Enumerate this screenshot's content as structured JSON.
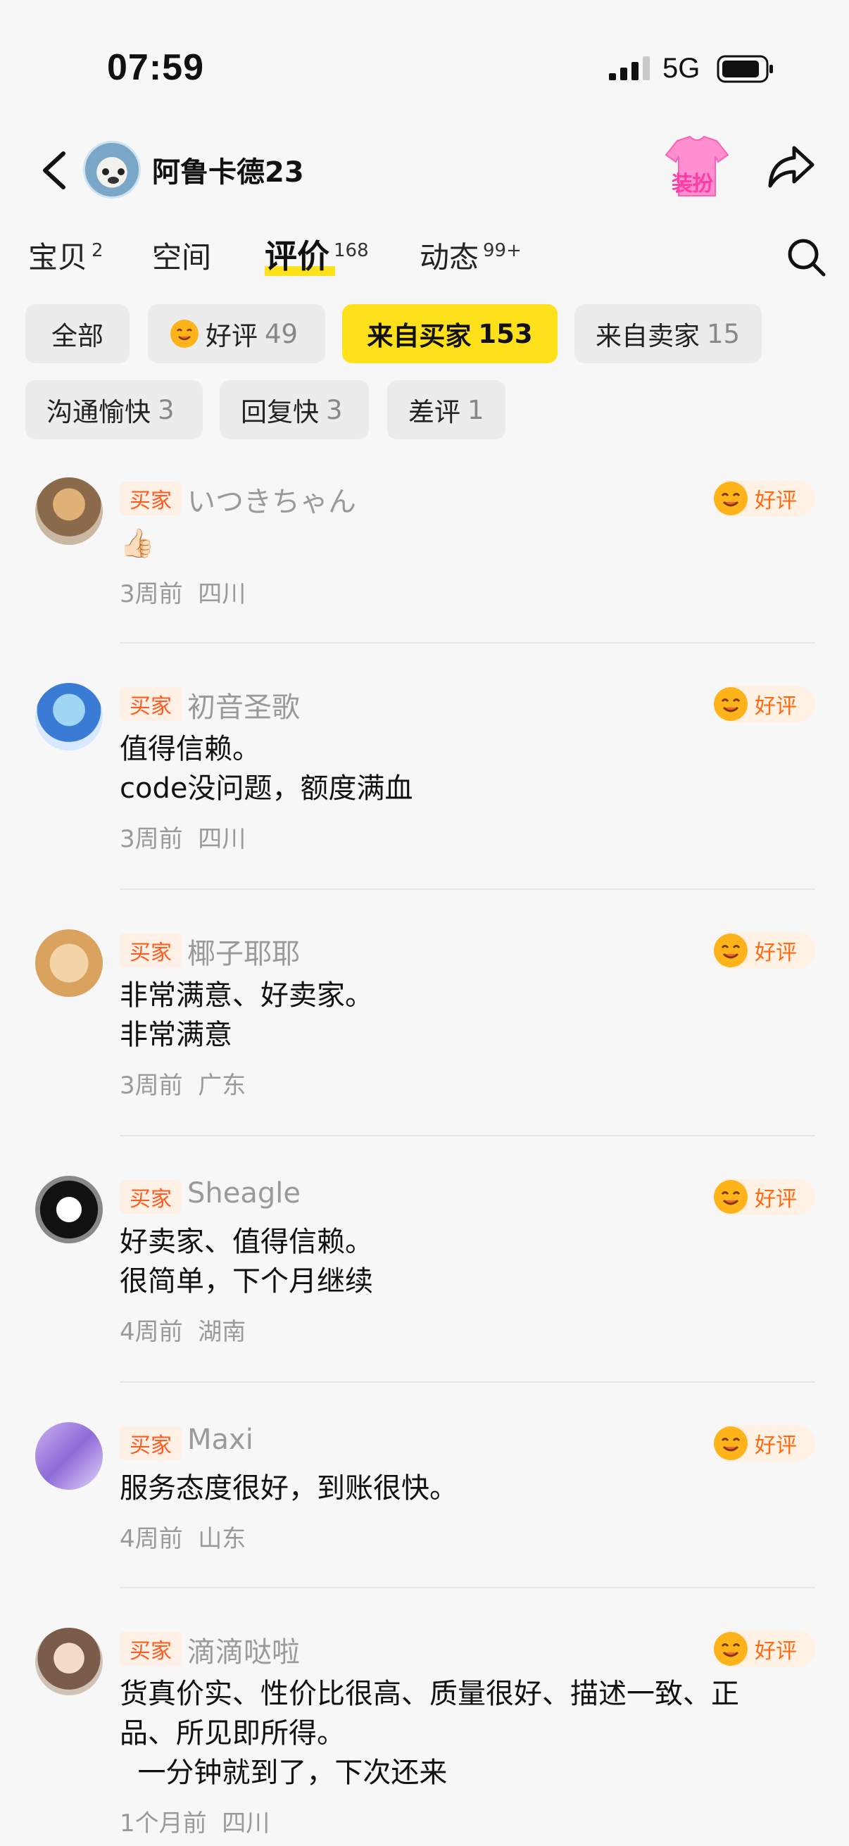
{
  "status_bar": {
    "time": "07:59",
    "network": "5G"
  },
  "header": {
    "user_name": "阿鲁卡德23",
    "dressup_label": "装扮"
  },
  "tabs": [
    {
      "label": "宝贝",
      "count": "2"
    },
    {
      "label": "空间",
      "count": ""
    },
    {
      "label": "评价",
      "count": "168",
      "active": true
    },
    {
      "label": "动态",
      "count": "99+"
    }
  ],
  "filters": [
    {
      "label": "全部",
      "count": ""
    },
    {
      "label": "好评",
      "count": "49"
    },
    {
      "label": "来自买家",
      "count": "153",
      "active": true
    },
    {
      "label": "来自卖家",
      "count": "15"
    },
    {
      "label": "沟通愉快",
      "count": "3"
    },
    {
      "label": "回复快",
      "count": "3"
    },
    {
      "label": "差评",
      "count": "1"
    }
  ],
  "reviews": [
    {
      "tag": "买家",
      "name": "いつきちゃん",
      "badge": "好评",
      "text": "👍🏻",
      "meta": "3周前  四川"
    },
    {
      "tag": "买家",
      "name": "初音圣歌",
      "badge": "好评",
      "text": "值得信赖。\ncode没问题，额度满血",
      "meta": "3周前  四川"
    },
    {
      "tag": "买家",
      "name": "椰子耶耶",
      "badge": "好评",
      "text": "非常满意、好卖家。\n非常满意",
      "meta": "3周前  广东"
    },
    {
      "tag": "买家",
      "name": "Sheagle",
      "badge": "好评",
      "text": "好卖家、值得信赖。\n很简单，下个月继续",
      "meta": "4周前  湖南"
    },
    {
      "tag": "买家",
      "name": "Maxi",
      "badge": "好评",
      "text": "服务态度很好，到账很快。",
      "meta": "4周前  山东"
    },
    {
      "tag": "买家",
      "name": "滴滴哒啦",
      "badge": "好评",
      "text": "货真价实、性价比很高、质量很好、描述一致、正\n品、所见即所得。\n  一分钟就到了，下次还来",
      "meta": "1个月前  四川"
    }
  ],
  "colors": {
    "accent_yellow": "#ffe11b",
    "tag_orange": "#ff5a1f",
    "badge_bg": "#fff1e3"
  }
}
